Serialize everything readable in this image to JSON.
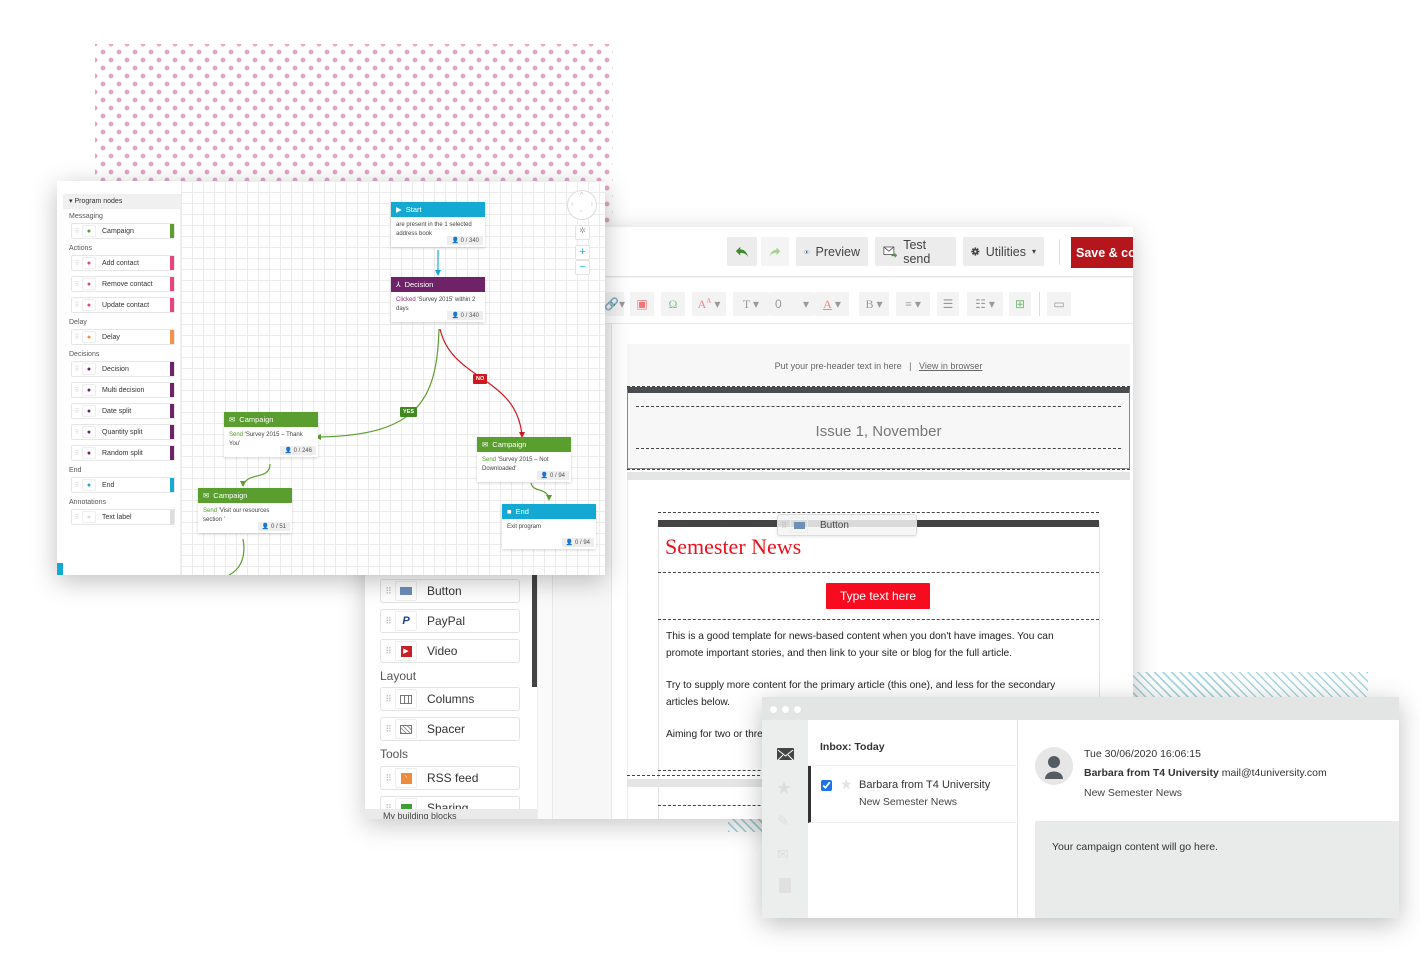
{
  "program_builder": {
    "panel_title": "Program nodes",
    "sections": [
      {
        "label": "Messaging",
        "items": [
          {
            "label": "Campaign",
            "icon": "envelope-icon",
            "color": "#5a9e2f"
          }
        ]
      },
      {
        "label": "Actions",
        "items": [
          {
            "label": "Add contact",
            "icon": "add-contact-icon",
            "color": "#e8457e"
          },
          {
            "label": "Remove contact",
            "icon": "remove-contact-icon",
            "color": "#e8457e"
          },
          {
            "label": "Update contact",
            "icon": "update-contact-icon",
            "color": "#e8457e"
          }
        ]
      },
      {
        "label": "Delay",
        "items": [
          {
            "label": "Delay",
            "icon": "timer-icon",
            "color": "#f2924a"
          }
        ]
      },
      {
        "label": "Decisions",
        "items": [
          {
            "label": "Decision",
            "icon": "decision-icon",
            "color": "#6e2368"
          },
          {
            "label": "Multi decision",
            "icon": "multi-decision-icon",
            "color": "#6e2368"
          },
          {
            "label": "Date split",
            "icon": "date-split-icon",
            "color": "#6e2368"
          },
          {
            "label": "Quantity split",
            "icon": "quantity-split-icon",
            "color": "#6e2368"
          },
          {
            "label": "Random split",
            "icon": "random-split-icon",
            "color": "#6e2368"
          }
        ]
      },
      {
        "label": "End",
        "items": [
          {
            "label": "End",
            "icon": "end-icon",
            "color": "#17a9d4"
          }
        ]
      },
      {
        "label": "Annotations",
        "items": [
          {
            "label": "Text label",
            "icon": "text-icon",
            "color": "#dddddd"
          }
        ]
      }
    ],
    "nodes": {
      "start": {
        "title": "Start",
        "body": "are present in the 1 selected address book",
        "count": "0 / 340",
        "color": "#13a9d3"
      },
      "decision": {
        "title": "Decision",
        "keyword": "Clicked",
        "body": " 'Survey 2015' within 2 days",
        "count": "0 / 340",
        "color": "#6e2368"
      },
      "campaign_yes": {
        "title": "Campaign",
        "keyword": "Send",
        "body": " 'Survey 2015 – Thank You'",
        "count": "0 / 246",
        "color": "#5a9e2f"
      },
      "campaign_no": {
        "title": "Campaign",
        "keyword": "Send",
        "body": " 'Survey 2015 – Not Downloaded'",
        "count": "0 / 94",
        "color": "#5a9e2f"
      },
      "campaign_resources": {
        "title": "Campaign",
        "keyword": "Send",
        "body": " 'Visit our resources section '",
        "count": "0 / 51",
        "color": "#5a9e2f"
      },
      "end": {
        "title": "End",
        "body": "Exit program",
        "count": "0 / 94",
        "color": "#13a9d3"
      }
    },
    "branch_labels": {
      "yes": "YES",
      "no": "NO"
    },
    "zoom_controls": {
      "zoom_in": "+",
      "zoom_out": "−"
    }
  },
  "email_editor": {
    "toolbar": {
      "undo": "undo",
      "redo": "redo",
      "preview": "Preview",
      "test_send": "Test send",
      "utilities": "Utilities",
      "save": "Save & continue"
    },
    "format_toolbar": {
      "font_size_value": "0"
    },
    "blocks": [
      {
        "label": "Button",
        "icon": "button-block-icon"
      },
      {
        "label": "PayPal",
        "icon": "paypal-icon"
      },
      {
        "label": "Video",
        "icon": "video-icon"
      }
    ],
    "layout_section": "Layout",
    "layout_blocks": [
      {
        "label": "Columns",
        "icon": "columns-icon"
      },
      {
        "label": "Spacer",
        "icon": "spacer-icon"
      }
    ],
    "tools_section": "Tools",
    "tools_blocks": [
      {
        "label": "RSS feed",
        "icon": "rss-icon"
      },
      {
        "label": "Sharing",
        "icon": "sharing-icon"
      }
    ],
    "bottom_label": "My building blocks",
    "drag_ghost": "Button",
    "template": {
      "preheader": "Put your pre-header text in here",
      "separator": "|",
      "view_in_browser": "View in browser",
      "issue": "Issue 1, November",
      "title": "Semester News",
      "cta": "Type text here",
      "paragraphs": [
        "This is a good template for news-based content when you don't have images. You can promote important stories, and then link to your site or blog for the full article.",
        "Try to supply more content for the primary article (this one), and less for the secondary articles below.",
        "Aiming for two or three secondary articles is best; you can change the article subject"
      ]
    }
  },
  "inbox": {
    "list_header": "Inbox: Today",
    "message": {
      "sender": "Barbara from T4 University",
      "subject": "New Semester News",
      "checked": true
    },
    "reader": {
      "date": "Tue 30/06/2020 16:06:15",
      "sender_name": "Barbara from T4 University",
      "sender_email": "mail@t4university.com",
      "subject": "New Semester News",
      "content": "Your campaign content will go here."
    }
  }
}
